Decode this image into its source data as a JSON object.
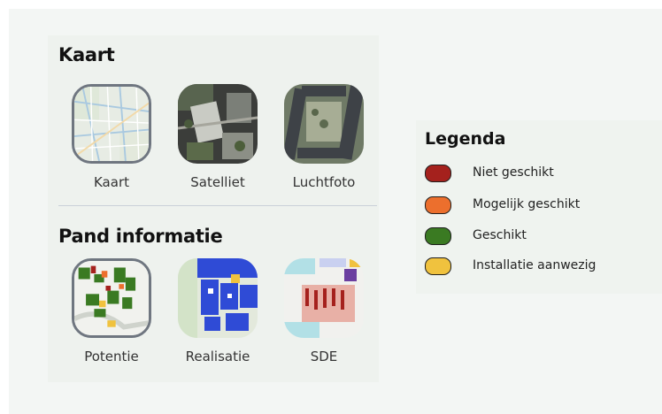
{
  "kaart": {
    "title": "Kaart",
    "options": [
      {
        "label": "Kaart",
        "selected": true,
        "icon": "street-map-thumbnail"
      },
      {
        "label": "Satelliet",
        "selected": false,
        "icon": "satellite-thumbnail"
      },
      {
        "label": "Luchtfoto",
        "selected": false,
        "icon": "aerial-photo-thumbnail"
      }
    ]
  },
  "pand": {
    "title": "Pand informatie",
    "options": [
      {
        "label": "Potentie",
        "selected": true,
        "icon": "potential-map-thumbnail"
      },
      {
        "label": "Realisatie",
        "selected": false,
        "icon": "realisation-map-thumbnail"
      },
      {
        "label": "SDE",
        "selected": false,
        "icon": "sde-map-thumbnail"
      }
    ]
  },
  "legend": {
    "title": "Legenda",
    "items": [
      {
        "label": "Niet geschikt",
        "color": "#a5211d"
      },
      {
        "label": "Mogelijk geschikt",
        "color": "#ec6f2d"
      },
      {
        "label": "Geschikt",
        "color": "#3a7a22"
      },
      {
        "label": "Installatie aanwezig",
        "color": "#f0c23e"
      }
    ]
  },
  "colors": {
    "background": "#f3f6f4",
    "selected_border": "#6f7680",
    "divider": "#c9d0d8"
  }
}
